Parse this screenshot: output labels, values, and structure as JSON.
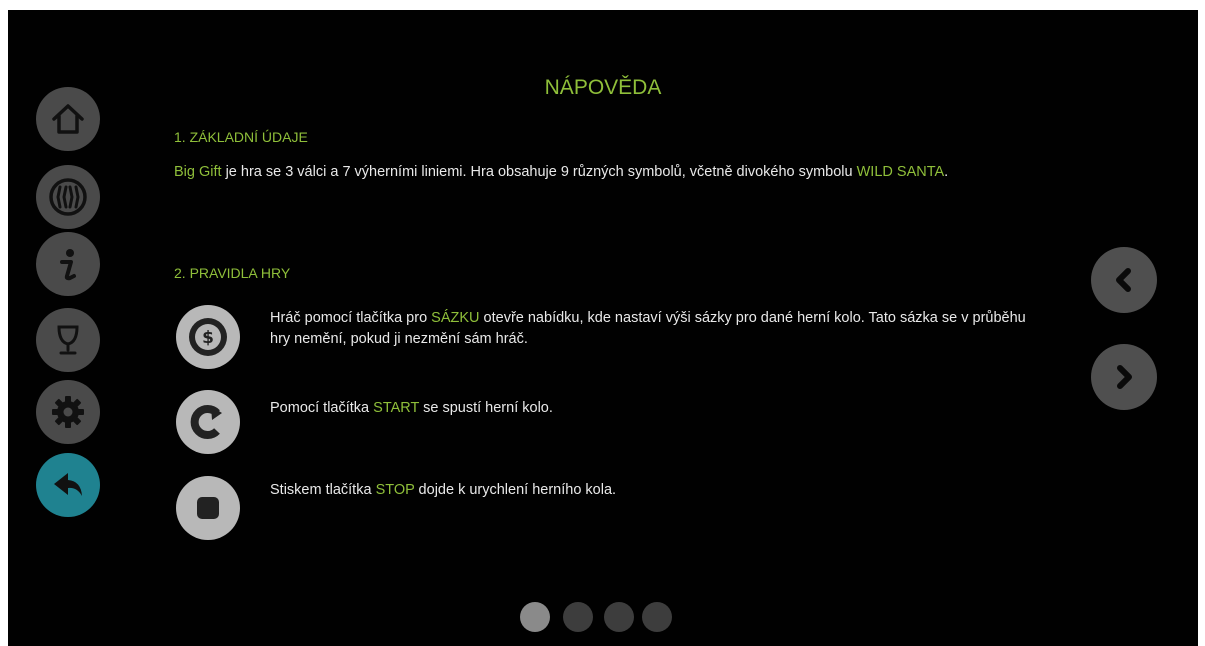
{
  "title": "NÁPOVĚDA",
  "section1": {
    "heading": "1. ZÁKLADNÍ ÚDAJE",
    "game_name": "Big Gift",
    "text_a": " je hra se 3 válci a 7 výherními liniemi. Hra obsahuje 9 různých symbolů, včetně divokého symbolu ",
    "wild": "WILD SANTA",
    "text_b": "."
  },
  "section2": {
    "heading": "2. PRAVIDLA HRY",
    "rules": [
      {
        "icon": "coin-bet-icon",
        "pre": "Hráč pomocí tlačítka pro ",
        "keyword": "SÁZKU",
        "post": " otevře nabídku, kde nastaví výši sázky pro dané herní kolo. Tato sázka se v průběhu hry nemění, pokud ji nezmění sám hráč."
      },
      {
        "icon": "start-spin-icon",
        "pre": "Pomocí tlačítka ",
        "keyword": "START",
        "post": " se spustí herní kolo."
      },
      {
        "icon": "stop-icon",
        "pre": "Stiskem tlačítka ",
        "keyword": "STOP",
        "post": " dojde k urychlení herního kola."
      }
    ]
  },
  "sidebar": [
    "home-icon",
    "paylines-icon",
    "info-icon",
    "trophy-icon",
    "settings-icon",
    "back-icon"
  ],
  "pagination": {
    "pages": 4,
    "current": 1
  },
  "colors": {
    "accent": "#8fbf3a",
    "active_button": "#1f8290",
    "button": "#4a4a4a",
    "background": "#010101"
  }
}
